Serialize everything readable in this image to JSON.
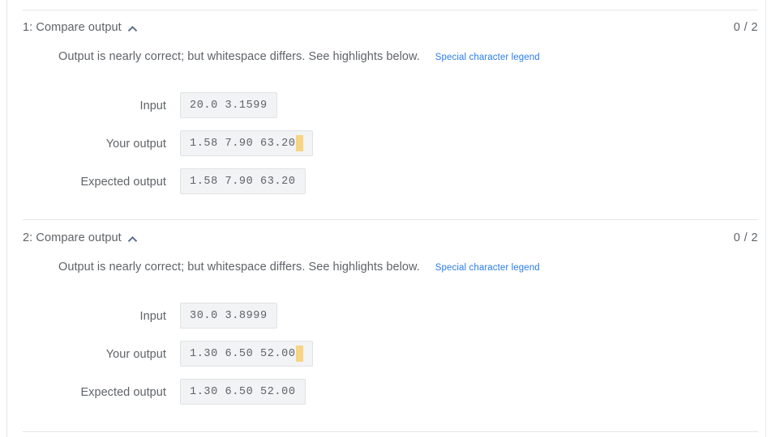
{
  "panel": {
    "score_separator": "/"
  },
  "icons": {
    "collapse": "chevron-up-icon"
  },
  "sections": [
    {
      "title": "1: Compare output",
      "score": "0 / 2",
      "message": "Output is nearly correct; but whitespace differs. See highlights below.",
      "legend_link": "Special character legend",
      "rows": [
        {
          "label": "Input",
          "value": "20.0 3.1599",
          "highlight": false
        },
        {
          "label": "Your output",
          "value": "1.58 7.90 63.20",
          "highlight": true
        },
        {
          "label": "Expected output",
          "value": "1.58 7.90 63.20",
          "highlight": false
        }
      ]
    },
    {
      "title": "2: Compare output",
      "score": "0 / 2",
      "message": "Output is nearly correct; but whitespace differs. See highlights below.",
      "legend_link": "Special character legend",
      "rows": [
        {
          "label": "Input",
          "value": "30.0 3.8999",
          "highlight": false
        },
        {
          "label": "Your output",
          "value": "1.30 6.50 52.00",
          "highlight": true
        },
        {
          "label": "Expected output",
          "value": "1.30 6.50 52.00",
          "highlight": false
        }
      ]
    }
  ],
  "colors": {
    "link": "#2b7de9",
    "text": "#5f6368",
    "highlight": "#f6d481",
    "box_bg": "#f1f3f4",
    "divider": "#e4e6e8"
  }
}
